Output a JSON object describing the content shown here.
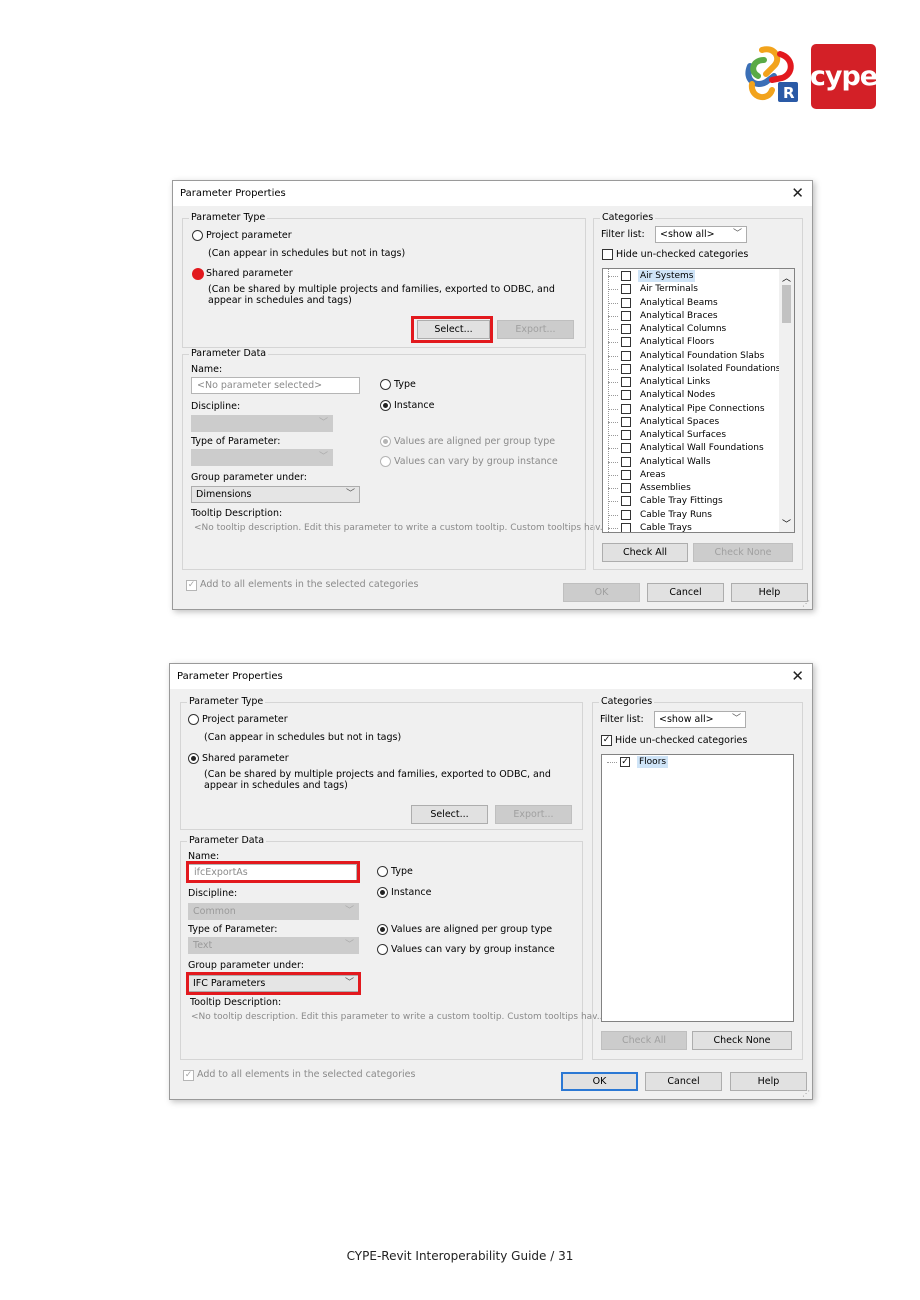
{
  "logos": {
    "cype_text": "cype",
    "revit_letter": "R"
  },
  "dialog1": {
    "title": "Parameter Properties",
    "parameter_type_legend": "Parameter Type",
    "project_param_label": "Project parameter",
    "project_param_desc": "(Can appear in schedules but not in tags)",
    "shared_param_label": "Shared parameter",
    "shared_param_desc_1": "(Can be shared by multiple projects and families, exported to ODBC, and",
    "shared_param_desc_2": "appear in schedules and tags)",
    "select_btn": "Select...",
    "export_btn": "Export...",
    "parameter_data_legend": "Parameter Data",
    "name_label": "Name:",
    "name_value": "<No parameter selected>",
    "type_radio": "Type",
    "instance_radio": "Instance",
    "discipline_label": "Discipline:",
    "discipline_value": "",
    "type_of_param_label": "Type of Parameter:",
    "type_of_param_value": "",
    "aligned_radio": "Values are aligned per group type",
    "vary_radio": "Values can vary by group instance",
    "group_under_label": "Group parameter under:",
    "group_under_value": "Dimensions",
    "tooltip_label": "Tooltip Description:",
    "tooltip_value": "<No tooltip description. Edit this parameter to write a custom tooltip. Custom tooltips hav...",
    "add_to_all_label": "Add to all elements in the selected categories",
    "categories_legend": "Categories",
    "filter_label": "Filter list:",
    "filter_value": "<show all>",
    "hide_unchecked_label": "Hide un-checked categories",
    "categories": [
      "Air Systems",
      "Air Terminals",
      "Analytical Beams",
      "Analytical Braces",
      "Analytical Columns",
      "Analytical Floors",
      "Analytical Foundation Slabs",
      "Analytical Isolated Foundations",
      "Analytical Links",
      "Analytical Nodes",
      "Analytical Pipe Connections",
      "Analytical Spaces",
      "Analytical Surfaces",
      "Analytical Wall Foundations",
      "Analytical Walls",
      "Areas",
      "Assemblies",
      "Cable Tray Fittings",
      "Cable Tray Runs",
      "Cable Trays"
    ],
    "check_all_btn": "Check All",
    "check_none_btn": "Check None",
    "ok_btn": "OK",
    "cancel_btn": "Cancel",
    "help_btn": "Help"
  },
  "dialog2": {
    "title": "Parameter Properties",
    "parameter_type_legend": "Parameter Type",
    "project_param_label": "Project parameter",
    "project_param_desc": "(Can appear in schedules but not in tags)",
    "shared_param_label": "Shared parameter",
    "shared_param_desc_1": "(Can be shared by multiple projects and families, exported to ODBC, and",
    "shared_param_desc_2": "appear in schedules and tags)",
    "select_btn": "Select...",
    "export_btn": "Export...",
    "parameter_data_legend": "Parameter Data",
    "name_label": "Name:",
    "name_value": "ifcExportAs",
    "type_radio": "Type",
    "instance_radio": "Instance",
    "discipline_label": "Discipline:",
    "discipline_value": "Common",
    "type_of_param_label": "Type of Parameter:",
    "type_of_param_value": "Text",
    "aligned_radio": "Values are aligned per group type",
    "vary_radio": "Values can vary by group instance",
    "group_under_label": "Group parameter under:",
    "group_under_value": "IFC Parameters",
    "tooltip_label": "Tooltip Description:",
    "tooltip_value": "<No tooltip description. Edit this parameter to write a custom tooltip. Custom tooltips hav...",
    "add_to_all_label": "Add to all elements in the selected categories",
    "categories_legend": "Categories",
    "filter_label": "Filter list:",
    "filter_value": "<show all>",
    "hide_unchecked_label": "Hide un-checked categories",
    "categories": [
      "Floors"
    ],
    "check_all_btn": "Check All",
    "check_none_btn": "Check None",
    "ok_btn": "OK",
    "cancel_btn": "Cancel",
    "help_btn": "Help"
  },
  "footer": {
    "text": "CYPE-Revit Interoperability Guide /  31"
  },
  "colors": {
    "highlight_red": "#e2191e",
    "cype_red": "#d32027",
    "selection_blue": "#cfe4f7"
  }
}
